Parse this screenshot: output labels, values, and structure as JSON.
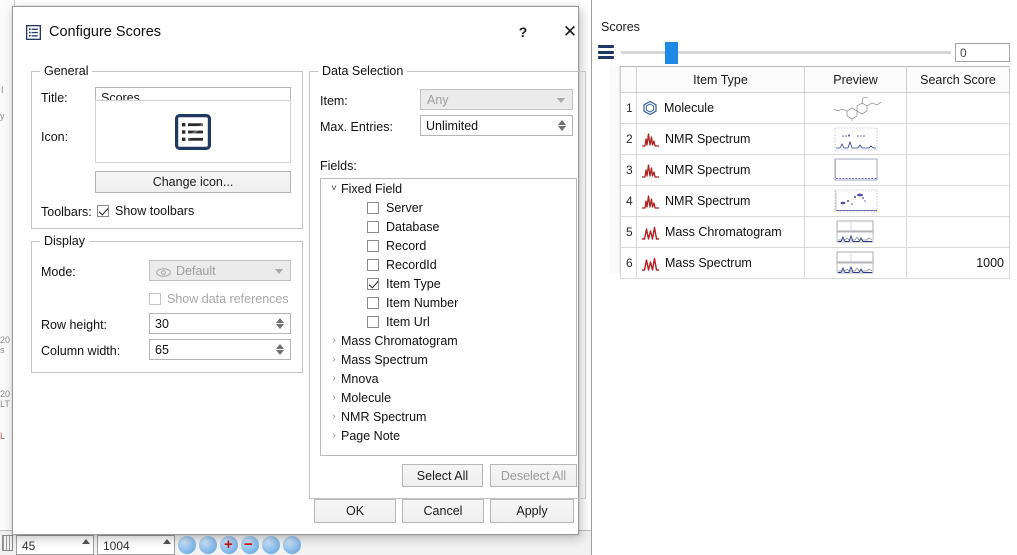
{
  "dialog": {
    "title": "Configure Scores",
    "icon": "list-view-icon",
    "help_label": "?",
    "close_label": "✕",
    "general": {
      "legend": "General",
      "title_label": "Title:",
      "title_value": "Scores",
      "icon_label": "Icon:",
      "icon_preview": "list-view-icon",
      "change_icon_label": "Change icon...",
      "toolbars_label": "Toolbars:",
      "show_toolbars_label": "Show toolbars",
      "show_toolbars_checked": true
    },
    "display": {
      "legend": "Display",
      "mode_label": "Mode:",
      "mode_value": "Default",
      "mode_icon": "eye-icon",
      "mode_disabled": true,
      "show_data_refs_label": "Show data references",
      "show_data_refs_checked": false,
      "show_data_refs_disabled": true,
      "row_height_label": "Row height:",
      "row_height_value": "30",
      "column_width_label": "Column width:",
      "column_width_value": "65"
    },
    "data_selection": {
      "legend": "Data Selection",
      "item_label": "Item:",
      "item_value": "Any",
      "item_disabled": true,
      "max_entries_label": "Max. Entries:",
      "max_entries_value": "Unlimited",
      "fields_label": "Fields:",
      "tree": [
        {
          "label": "Fixed Field",
          "type": "group",
          "expanded": true
        },
        {
          "label": "Server",
          "type": "field",
          "checked": false
        },
        {
          "label": "Database",
          "type": "field",
          "checked": false
        },
        {
          "label": "Record",
          "type": "field",
          "checked": false
        },
        {
          "label": "RecordId",
          "type": "field",
          "checked": false
        },
        {
          "label": "Item Type",
          "type": "field",
          "checked": true
        },
        {
          "label": "Item Number",
          "type": "field",
          "checked": false
        },
        {
          "label": "Item Url",
          "type": "field",
          "checked": false
        },
        {
          "label": "Mass Chromatogram",
          "type": "group",
          "expanded": false
        },
        {
          "label": "Mass Spectrum",
          "type": "group",
          "expanded": false
        },
        {
          "label": "Mnova",
          "type": "group",
          "expanded": false
        },
        {
          "label": "Molecule",
          "type": "group",
          "expanded": false
        },
        {
          "label": "NMR Spectrum",
          "type": "group",
          "expanded": false
        },
        {
          "label": "Page Note",
          "type": "group",
          "expanded": false
        }
      ],
      "select_all_label": "Select All",
      "deselect_all_label": "Deselect All"
    },
    "buttons": {
      "ok_label": "OK",
      "cancel_label": "Cancel",
      "apply_label": "Apply"
    }
  },
  "scores_panel": {
    "title": "Scores",
    "menu_icon": "hamburger-icon",
    "slider_value": "0",
    "slider_position_pct": 13,
    "columns": [
      "",
      "Item Type",
      "Preview",
      "Search Score"
    ],
    "rows": [
      {
        "num": "1",
        "icon": "molecule-icon",
        "item_type": "Molecule",
        "preview": "molecule-structure-thumbnail",
        "score": ""
      },
      {
        "num": "2",
        "icon": "nmr-spectrum-icon",
        "item_type": "NMR Spectrum",
        "preview": "nmr-spectrum-thumbnail",
        "score": ""
      },
      {
        "num": "3",
        "icon": "nmr-spectrum-icon",
        "item_type": "NMR Spectrum",
        "preview": "nmr-spectrum-thumbnail",
        "score": ""
      },
      {
        "num": "4",
        "icon": "nmr-spectrum-icon",
        "item_type": "NMR Spectrum",
        "preview": "nmr-2d-spectrum-thumbnail",
        "score": ""
      },
      {
        "num": "5",
        "icon": "mass-chromatogram-icon",
        "item_type": "Mass Chromatogram",
        "preview": "chromatogram-thumbnail",
        "score": ""
      },
      {
        "num": "6",
        "icon": "mass-spectrum-icon",
        "item_type": "Mass Spectrum",
        "preview": "mass-spectrum-thumbnail",
        "score": "1000"
      }
    ]
  },
  "background": {
    "spinner_left_value": "45",
    "spinner_right_value": "1004"
  },
  "colors": {
    "accent": "#1e8ae6",
    "icon_blue": "#1f3864",
    "molecule_icon": "#2b5f9e",
    "spectrum_icon": "#b02020",
    "dialog_border": "#9a9a9a"
  }
}
